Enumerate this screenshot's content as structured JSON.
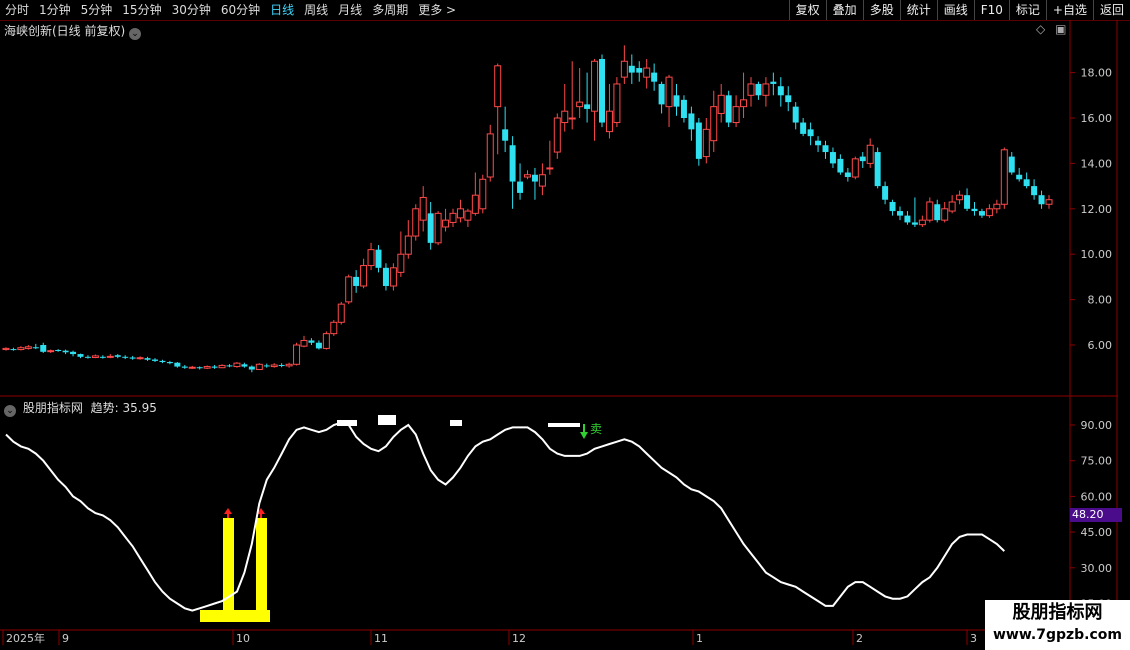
{
  "toolbar": {
    "periods": [
      "分时",
      "1分钟",
      "5分钟",
      "15分钟",
      "30分钟",
      "60分钟",
      "日线",
      "周线",
      "月线",
      "多周期",
      "更多 >"
    ],
    "active_period": "日线",
    "actions": [
      "复权",
      "叠加",
      "多股",
      "统计",
      "画线",
      "F10",
      "标记",
      "+自选",
      "返回"
    ]
  },
  "main_panel": {
    "title": "海峡创新(日线 前复权)",
    "price_axis": [
      "18.00",
      "16.00",
      "14.00",
      "12.00",
      "10.00",
      "8.00",
      "6.00"
    ]
  },
  "indicator_panel": {
    "title": "股朋指标网",
    "value_label": "趋势: 35.95",
    "axis": [
      "90.00",
      "75.00",
      "60.00",
      "45.00",
      "30.00",
      "15.00"
    ],
    "current_tag": "48.20",
    "sell_label": "卖"
  },
  "time_axis": [
    "2025年",
    "9",
    "10",
    "11",
    "12",
    "1",
    "2",
    "3"
  ],
  "watermark": {
    "line1": "股朋指标网",
    "line2": "www.7gpzb.com"
  },
  "colors": {
    "up": "#ff4a4a",
    "down": "#2fe0f0",
    "line": "#ffffff",
    "signal": "#ffff00",
    "arrow_up": "#ff2020",
    "arrow_down": "#30d030"
  },
  "chart_data": {
    "type": "candlestick",
    "candles": [
      [
        5.8,
        5.85,
        5.9,
        5.75
      ],
      [
        5.82,
        5.8,
        5.88,
        5.75
      ],
      [
        5.8,
        5.88,
        5.95,
        5.76
      ],
      [
        5.85,
        5.92,
        6.0,
        5.8
      ],
      [
        5.9,
        5.88,
        6.05,
        5.82
      ],
      [
        6.0,
        5.7,
        6.1,
        5.65
      ],
      [
        5.72,
        5.75,
        5.8,
        5.65
      ],
      [
        5.78,
        5.74,
        5.82,
        5.7
      ],
      [
        5.75,
        5.68,
        5.8,
        5.6
      ],
      [
        5.7,
        5.6,
        5.75,
        5.5
      ],
      [
        5.6,
        5.48,
        5.62,
        5.42
      ],
      [
        5.48,
        5.45,
        5.55,
        5.4
      ],
      [
        5.45,
        5.52,
        5.58,
        5.42
      ],
      [
        5.48,
        5.46,
        5.55,
        5.4
      ],
      [
        5.46,
        5.5,
        5.6,
        5.42
      ],
      [
        5.55,
        5.48,
        5.6,
        5.42
      ],
      [
        5.48,
        5.45,
        5.55,
        5.38
      ],
      [
        5.45,
        5.4,
        5.52,
        5.35
      ],
      [
        5.4,
        5.44,
        5.5,
        5.35
      ],
      [
        5.42,
        5.35,
        5.48,
        5.3
      ],
      [
        5.36,
        5.3,
        5.42,
        5.25
      ],
      [
        5.3,
        5.25,
        5.35,
        5.2
      ],
      [
        5.25,
        5.2,
        5.3,
        5.15
      ],
      [
        5.22,
        5.05,
        5.25,
        5.0
      ],
      [
        5.05,
        5.0,
        5.12,
        4.95
      ],
      [
        5.0,
        5.02,
        5.08,
        4.95
      ],
      [
        5.02,
        4.98,
        5.06,
        4.92
      ],
      [
        4.98,
        5.05,
        5.1,
        4.94
      ],
      [
        5.05,
        5.0,
        5.12,
        4.95
      ],
      [
        5.0,
        5.1,
        5.15,
        4.98
      ],
      [
        5.1,
        5.08,
        5.16,
        5.02
      ],
      [
        5.05,
        5.2,
        5.25,
        5.0
      ],
      [
        5.15,
        5.05,
        5.22,
        5.0
      ],
      [
        5.05,
        4.92,
        5.1,
        4.8
      ],
      [
        4.92,
        5.15,
        5.2,
        4.9
      ],
      [
        5.1,
        5.08,
        5.18,
        5.0
      ],
      [
        5.05,
        5.12,
        5.2,
        5.0
      ],
      [
        5.12,
        5.08,
        5.2,
        5.02
      ],
      [
        5.08,
        5.15,
        5.22,
        5.0
      ],
      [
        5.15,
        6.0,
        6.1,
        5.1
      ],
      [
        5.95,
        6.2,
        6.4,
        5.9
      ],
      [
        6.2,
        6.1,
        6.3,
        6.0
      ],
      [
        6.1,
        5.85,
        6.2,
        5.8
      ],
      [
        5.85,
        6.5,
        6.6,
        5.8
      ],
      [
        6.5,
        7.0,
        7.1,
        6.4
      ],
      [
        7.0,
        7.8,
        7.9,
        6.9
      ],
      [
        7.9,
        9.0,
        9.1,
        7.8
      ],
      [
        9.0,
        8.6,
        9.3,
        8.3
      ],
      [
        8.6,
        9.5,
        9.8,
        8.5
      ],
      [
        9.5,
        10.2,
        10.5,
        9.3
      ],
      [
        10.2,
        9.4,
        10.4,
        9.2
      ],
      [
        9.4,
        8.6,
        9.6,
        8.4
      ],
      [
        8.6,
        9.4,
        9.6,
        8.4
      ],
      [
        9.2,
        10.0,
        11.0,
        9.0
      ],
      [
        10.0,
        10.8,
        11.5,
        9.8
      ],
      [
        10.8,
        12.0,
        12.2,
        10.6
      ],
      [
        11.5,
        12.5,
        13.0,
        11.0
      ],
      [
        11.8,
        10.5,
        12.3,
        10.2
      ],
      [
        10.5,
        11.8,
        11.9,
        10.4
      ],
      [
        11.2,
        11.5,
        12.0,
        11.0
      ],
      [
        11.4,
        11.8,
        12.0,
        11.2
      ],
      [
        11.6,
        12.0,
        12.4,
        11.4
      ],
      [
        11.5,
        11.9,
        12.0,
        11.2
      ],
      [
        11.8,
        12.6,
        13.6,
        11.7
      ],
      [
        12.0,
        13.3,
        13.5,
        11.8
      ],
      [
        13.4,
        15.3,
        15.7,
        13.2
      ],
      [
        16.5,
        18.3,
        18.4,
        14.4
      ],
      [
        15.5,
        15.0,
        16.5,
        14.5
      ],
      [
        14.8,
        13.2,
        15.2,
        12.0
      ],
      [
        13.2,
        12.7,
        14.0,
        12.4
      ],
      [
        13.4,
        13.5,
        13.7,
        13.3
      ],
      [
        13.5,
        13.2,
        13.8,
        12.4
      ],
      [
        13.0,
        13.5,
        14.0,
        12.6
      ],
      [
        13.8,
        13.8,
        15.0,
        13.5
      ],
      [
        14.5,
        16.0,
        16.2,
        14.2
      ],
      [
        15.8,
        16.3,
        17.5,
        15.4
      ],
      [
        16.0,
        16.0,
        18.5,
        15.5
      ],
      [
        16.5,
        16.7,
        18.2,
        16.0
      ],
      [
        16.6,
        16.4,
        18.0,
        15.8
      ],
      [
        16.3,
        18.5,
        18.6,
        15.0
      ],
      [
        18.6,
        15.8,
        18.8,
        15.6
      ],
      [
        15.4,
        16.3,
        17.5,
        15.1
      ],
      [
        15.8,
        17.5,
        17.8,
        15.6
      ],
      [
        17.8,
        18.5,
        19.2,
        17.5
      ],
      [
        18.3,
        18.0,
        18.8,
        17.5
      ],
      [
        18.2,
        18.0,
        18.5,
        17.6
      ],
      [
        17.8,
        18.2,
        18.6,
        17.3
      ],
      [
        18.0,
        17.6,
        18.4,
        17.2
      ],
      [
        17.5,
        16.6,
        17.6,
        16.2
      ],
      [
        16.5,
        17.8,
        17.9,
        15.6
      ],
      [
        17.0,
        16.5,
        17.5,
        16.1
      ],
      [
        16.8,
        16.0,
        17.0,
        15.8
      ],
      [
        16.2,
        15.5,
        16.5,
        15.0
      ],
      [
        15.8,
        14.2,
        16.0,
        13.9
      ],
      [
        14.3,
        15.5,
        16.0,
        14.0
      ],
      [
        15.0,
        16.5,
        17.2,
        14.5
      ],
      [
        16.2,
        17.0,
        17.5,
        15.8
      ],
      [
        17.0,
        15.8,
        17.2,
        15.6
      ],
      [
        15.8,
        16.5,
        17.0,
        15.6
      ],
      [
        16.5,
        16.8,
        18.0,
        16.0
      ],
      [
        17.0,
        17.5,
        17.8,
        16.5
      ],
      [
        17.5,
        17.0,
        17.6,
        16.8
      ],
      [
        17.0,
        17.5,
        17.8,
        16.5
      ],
      [
        17.6,
        17.5,
        18.0,
        17.0
      ],
      [
        17.4,
        17.0,
        17.8,
        16.5
      ],
      [
        17.0,
        16.7,
        17.4,
        16.3
      ],
      [
        16.5,
        15.8,
        16.7,
        15.5
      ],
      [
        15.8,
        15.3,
        16.0,
        15.2
      ],
      [
        15.5,
        15.2,
        15.8,
        14.8
      ],
      [
        15.0,
        14.8,
        15.2,
        14.5
      ],
      [
        14.8,
        14.5,
        15.0,
        14.2
      ],
      [
        14.5,
        14.0,
        14.7,
        13.8
      ],
      [
        14.2,
        13.6,
        14.4,
        13.5
      ],
      [
        13.6,
        13.4,
        13.8,
        13.2
      ],
      [
        13.4,
        14.2,
        14.3,
        13.3
      ],
      [
        14.3,
        14.1,
        14.5,
        13.8
      ],
      [
        14.0,
        14.8,
        15.1,
        13.8
      ],
      [
        14.5,
        13.0,
        14.7,
        12.9
      ],
      [
        13.0,
        12.4,
        13.2,
        12.2
      ],
      [
        12.3,
        11.9,
        12.4,
        11.7
      ],
      [
        11.9,
        11.7,
        12.1,
        11.5
      ],
      [
        11.7,
        11.4,
        11.9,
        11.3
      ],
      [
        11.4,
        11.3,
        12.5,
        11.2
      ],
      [
        11.3,
        11.5,
        11.7,
        11.2
      ],
      [
        11.5,
        12.3,
        12.5,
        11.4
      ],
      [
        12.2,
        11.5,
        12.4,
        11.4
      ],
      [
        11.5,
        12.0,
        12.3,
        11.4
      ],
      [
        11.9,
        12.3,
        12.6,
        11.8
      ],
      [
        12.4,
        12.6,
        12.8,
        12.2
      ],
      [
        12.6,
        12.0,
        12.9,
        11.9
      ],
      [
        12.0,
        11.9,
        12.3,
        11.7
      ],
      [
        11.9,
        11.7,
        12.0,
        11.6
      ],
      [
        11.7,
        12.0,
        12.2,
        11.6
      ],
      [
        12.0,
        12.2,
        12.4,
        11.8
      ],
      [
        12.2,
        14.6,
        14.7,
        12.0
      ],
      [
        14.3,
        13.6,
        14.5,
        13.5
      ],
      [
        13.5,
        13.3,
        13.8,
        13.2
      ],
      [
        13.3,
        13.0,
        13.6,
        12.9
      ],
      [
        13.0,
        12.6,
        13.3,
        12.4
      ],
      [
        12.6,
        12.2,
        12.8,
        12.0
      ],
      [
        12.2,
        12.4,
        12.6,
        12.0
      ],
      [
        12.3,
        12.5,
        12.8,
        12.1
      ],
      [
        12.5,
        12.7,
        12.9,
        12.3
      ],
      [
        12.7,
        12.6,
        12.9,
        12.5
      ],
      [
        12.6,
        13.2,
        13.5,
        12.4
      ],
      [
        12.8,
        13.0,
        13.9,
        12.7
      ],
      [
        12.7,
        13.1,
        13.2,
        12.5
      ],
      [
        13.0,
        14.3,
        14.8,
        12.8
      ],
      [
        13.5,
        15.4,
        16.0,
        13.2
      ],
      [
        14.9,
        14.8,
        15.2,
        13.5
      ],
      [
        14.8,
        14.3,
        15.0,
        14.0
      ],
      [
        14.3,
        14.2,
        14.5,
        13.9
      ],
      [
        14.1,
        13.9,
        14.3,
        13.6
      ],
      [
        13.9,
        13.6,
        14.0,
        13.3
      ],
      [
        13.6,
        13.2,
        13.7,
        13.0
      ],
      [
        13.2,
        13.0,
        13.3,
        12.9
      ]
    ],
    "indicator_values": [
      86,
      83,
      81,
      80,
      78,
      75,
      71,
      67,
      64,
      60,
      58,
      55,
      53,
      52,
      50,
      47,
      43,
      39,
      34,
      29,
      24,
      20,
      17,
      15,
      13,
      12,
      13,
      14,
      15,
      16,
      18,
      20,
      28,
      40,
      57,
      67,
      72,
      78,
      84,
      88,
      89,
      88,
      87,
      88,
      90,
      91,
      90,
      85,
      82,
      80,
      79,
      81,
      85,
      88,
      90,
      86,
      78,
      71,
      67,
      65,
      68,
      72,
      77,
      81,
      83,
      84,
      86,
      88,
      89,
      89,
      89,
      87,
      84,
      80,
      78,
      77,
      77,
      77,
      78,
      80,
      81,
      82,
      83,
      84,
      83,
      81,
      78,
      75,
      72,
      70,
      68,
      65,
      63,
      62,
      60,
      58,
      55,
      50,
      45,
      40,
      36,
      32,
      28,
      26,
      24,
      23,
      22,
      20,
      18,
      16,
      14,
      14,
      18,
      22,
      24,
      24,
      22,
      20,
      18,
      17,
      17,
      18,
      21,
      24,
      26,
      30,
      35,
      40,
      43,
      44,
      44,
      44,
      42,
      40,
      37
    ]
  }
}
